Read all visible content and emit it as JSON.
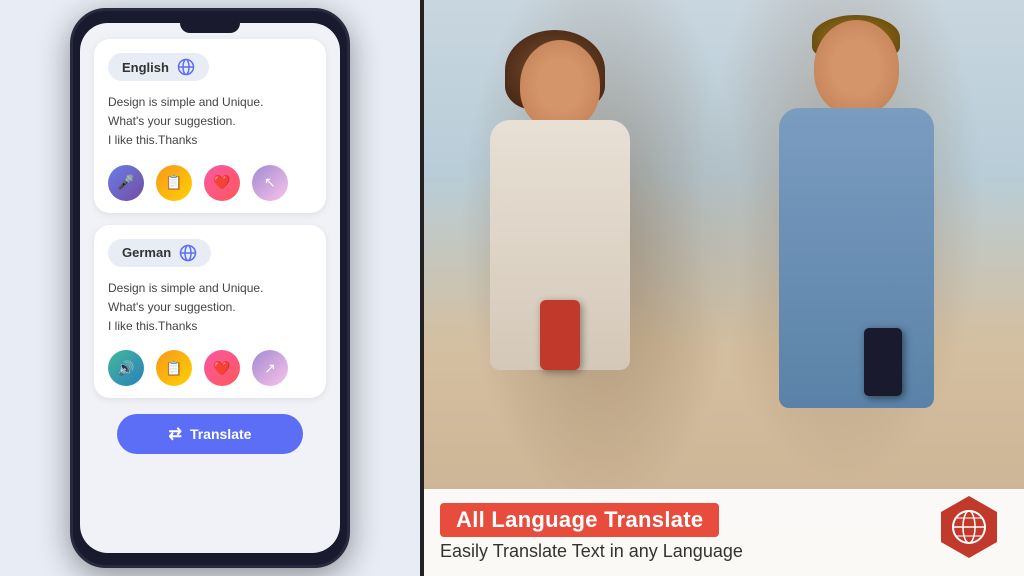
{
  "app": {
    "title": "All Language Translate"
  },
  "left_panel": {
    "bg_color": "#e8ecf5"
  },
  "phone": {
    "card1": {
      "language": "English",
      "text_line1": "Design is simple and Unique.",
      "text_line2": "What's your suggestion.",
      "text_line3": "I like this.Thanks"
    },
    "card2": {
      "language": "German",
      "text_line1": "Design is simple and Unique.",
      "text_line2": "What's your suggestion.",
      "text_line3": "I like this.Thanks"
    },
    "translate_btn": "Translate"
  },
  "right_panel": {
    "banner": {
      "title": "All Language Translate",
      "subtitle": "Easily Translate Text in any  Language"
    }
  },
  "icons": {
    "globe": "🌐",
    "mic": "🎤",
    "copy": "📋",
    "heart": "❤️",
    "share": "🔗",
    "volume": "🔊",
    "translate_icon": "⇄"
  }
}
